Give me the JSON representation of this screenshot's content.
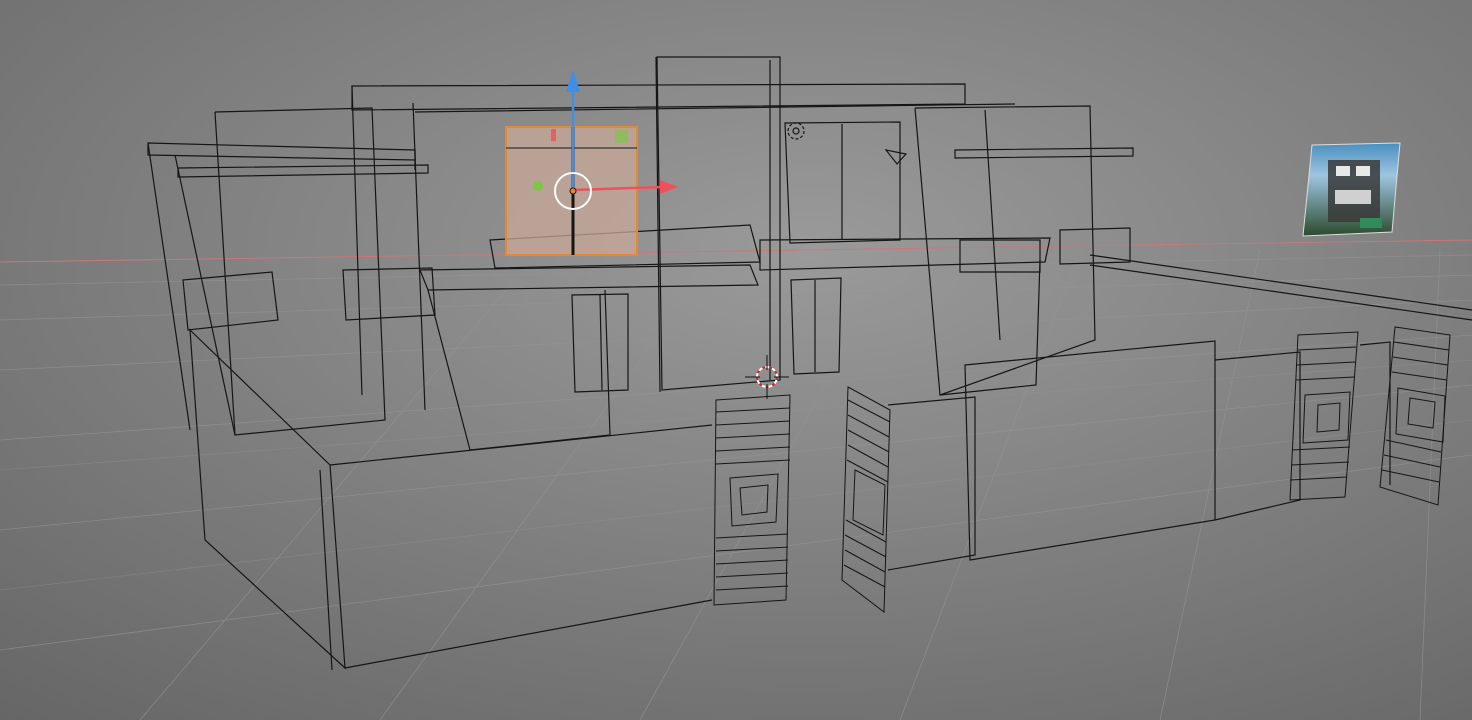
{
  "viewport": {
    "mode": "wireframe",
    "colors": {
      "background_top": "#8a8a8a",
      "background_bottom": "#6b6b6b",
      "grid": "#8f8f8f",
      "wire": "#151515",
      "x_axis_line": "#c9787a",
      "selected_face": "#c9a89a",
      "selected_outline": "#e8872c",
      "gizmo_x": "#f0505a",
      "gizmo_y": "#7ec646",
      "gizmo_z": "#3f8fe8",
      "cursor": "#c8262b"
    },
    "objects": [
      {
        "name": "house-building",
        "type": "mesh"
      },
      {
        "name": "selected-window",
        "type": "mesh",
        "selected": true
      },
      {
        "name": "gate-door-left",
        "type": "mesh"
      },
      {
        "name": "gate-door-right",
        "type": "mesh"
      },
      {
        "name": "gate-door-far-1",
        "type": "mesh"
      },
      {
        "name": "gate-door-far-2",
        "type": "mesh"
      },
      {
        "name": "boundary-wall",
        "type": "mesh"
      },
      {
        "name": "reference-image",
        "type": "image"
      }
    ],
    "icons": [
      "transform-gizmo",
      "3d-cursor-icon",
      "light-icon",
      "camera-icon"
    ]
  }
}
